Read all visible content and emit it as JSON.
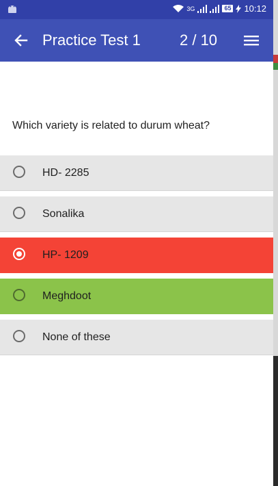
{
  "status_bar": {
    "battery": "65",
    "time": "10:12",
    "network": "3G"
  },
  "header": {
    "title": "Practice Test 1",
    "counter": "2  /  10"
  },
  "question": "Which variety is related to durum wheat?",
  "options": [
    {
      "label": "HD- 2285",
      "state": "normal"
    },
    {
      "label": "Sonalika",
      "state": "normal"
    },
    {
      "label": "HP- 1209",
      "state": "selected-wrong"
    },
    {
      "label": "Meghdoot",
      "state": "correct"
    },
    {
      "label": "None of these",
      "state": "normal"
    }
  ],
  "colors": {
    "status_bar": "#3140a8",
    "app_bar": "#3f51b5",
    "option_bg": "#e6e6e6",
    "wrong": "#f44336",
    "correct": "#8bc34a"
  }
}
